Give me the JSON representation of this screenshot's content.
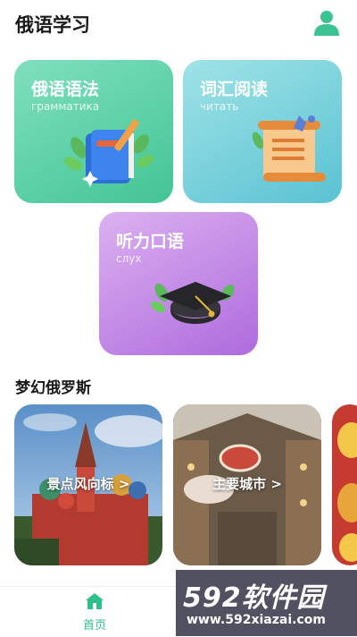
{
  "header": {
    "title": "俄语学习",
    "avatar_icon": "user-icon"
  },
  "cards": [
    {
      "title": "俄语语法",
      "subtitle": "грамматика",
      "icon": "book-icon"
    },
    {
      "title": "词汇阅读",
      "subtitle": "читать",
      "icon": "scroll-icon"
    },
    {
      "title": "听力口语",
      "subtitle": "слух",
      "icon": "graduation-cap-icon"
    }
  ],
  "section": {
    "title": "梦幻俄罗斯"
  },
  "photos": [
    {
      "label": "景点风向标 >",
      "icon": "kremlin-photo"
    },
    {
      "label": "主要城市 >",
      "icon": "city-photo"
    },
    {
      "label": "",
      "icon": "matryoshka-photo"
    }
  ],
  "tabbar": {
    "home_label": "首页",
    "home_icon": "home-icon"
  },
  "watermark": {
    "brand": "592软件园",
    "url": "www.592xiazai.com"
  },
  "colors": {
    "accent": "#2fbf8a",
    "grammar": "#43c495",
    "vocab": "#5ac2d2",
    "listen": "#ae6bdd"
  }
}
